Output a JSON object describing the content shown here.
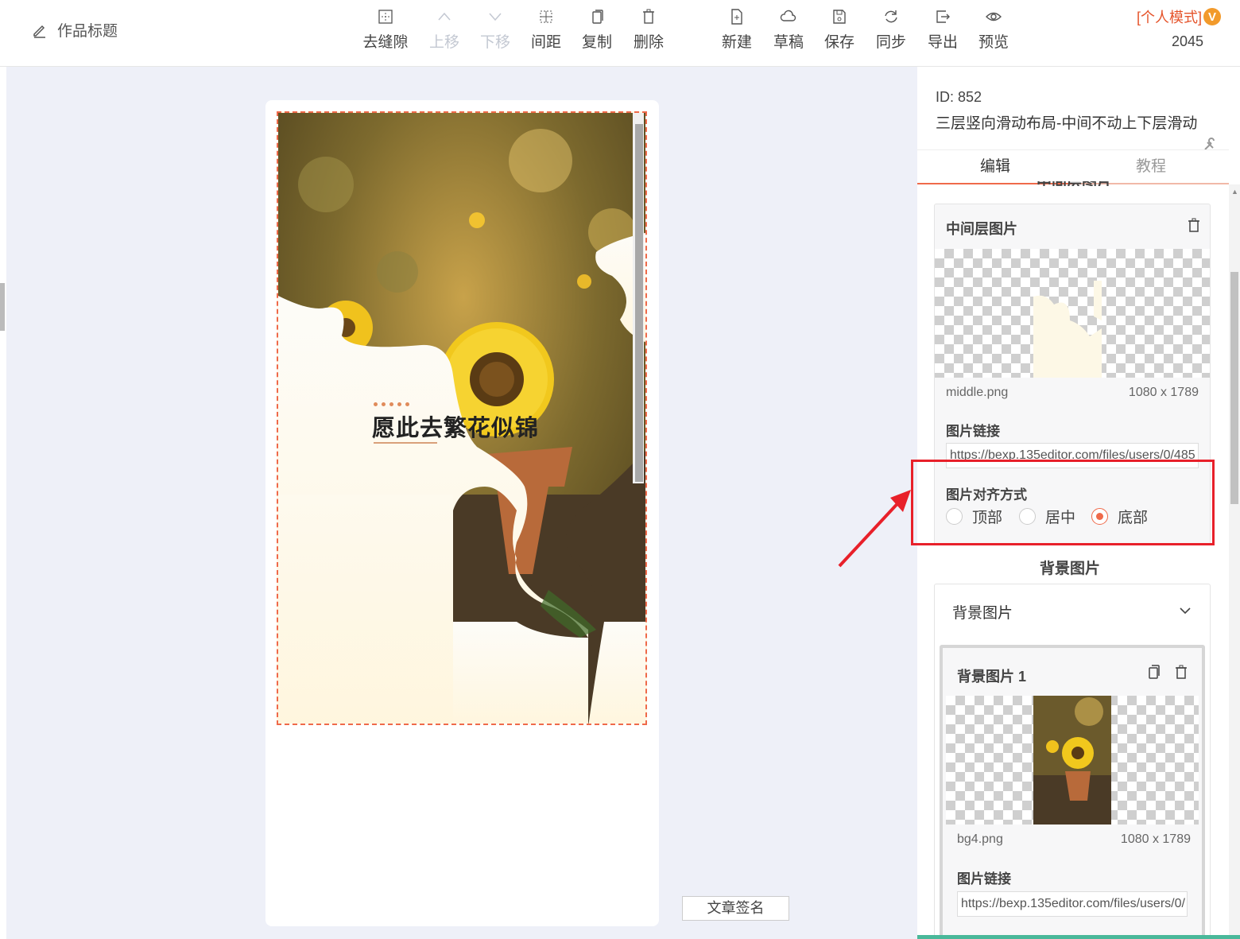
{
  "header": {
    "work_title": "作品标题",
    "tools": [
      {
        "label": "去缝隙",
        "icon": "gap-remove-icon",
        "enabled": true
      },
      {
        "label": "上移",
        "icon": "chevron-up-icon",
        "enabled": false
      },
      {
        "label": "下移",
        "icon": "chevron-down-icon",
        "enabled": false
      },
      {
        "label": "间距",
        "icon": "spacing-icon",
        "enabled": true
      },
      {
        "label": "复制",
        "icon": "copy-icon",
        "enabled": true
      },
      {
        "label": "删除",
        "icon": "trash-icon",
        "enabled": true
      },
      {
        "label": "新建",
        "icon": "new-file-icon",
        "enabled": true
      },
      {
        "label": "草稿",
        "icon": "cloud-icon",
        "enabled": true
      },
      {
        "label": "保存",
        "icon": "save-icon",
        "enabled": true
      },
      {
        "label": "同步",
        "icon": "sync-icon",
        "enabled": true
      },
      {
        "label": "导出",
        "icon": "export-icon",
        "enabled": true
      },
      {
        "label": "预览",
        "icon": "eye-icon",
        "enabled": true
      }
    ],
    "mode_label": "[个人模式]",
    "mode_badge": "V",
    "count": "2045"
  },
  "canvas": {
    "headline": "愿此去繁花似锦",
    "signature_button": "文章签名"
  },
  "panel": {
    "id_text": "ID: 852",
    "template_name": "三层竖向滑动布局-中间不动上下层滑动",
    "tabs": [
      {
        "label": "编辑",
        "active": true
      },
      {
        "label": "教程",
        "active": false
      }
    ],
    "clipped_section_title": "中间层图片",
    "middle_layer": {
      "title": "中间层图片",
      "file_name": "middle.png",
      "dimensions": "1080 x 1789",
      "link_label": "图片链接",
      "link_value": "https://bexp.135editor.com/files/users/0/485",
      "align_label": "图片对齐方式",
      "align_options": [
        {
          "label": "顶部",
          "checked": false
        },
        {
          "label": "居中",
          "checked": false
        },
        {
          "label": "底部",
          "checked": true
        }
      ]
    },
    "background_section": {
      "title": "背景图片",
      "collapse_label": "背景图片",
      "item": {
        "title": "背景图片 1",
        "file_name": "bg4.png",
        "dimensions": "1080 x 1789",
        "link_label": "图片链接",
        "link_value": "https://bexp.135editor.com/files/users/0/"
      }
    }
  },
  "colors": {
    "accent": "#ef6a4a",
    "highlight": "#e8202a",
    "mode_text": "#e5542b"
  }
}
